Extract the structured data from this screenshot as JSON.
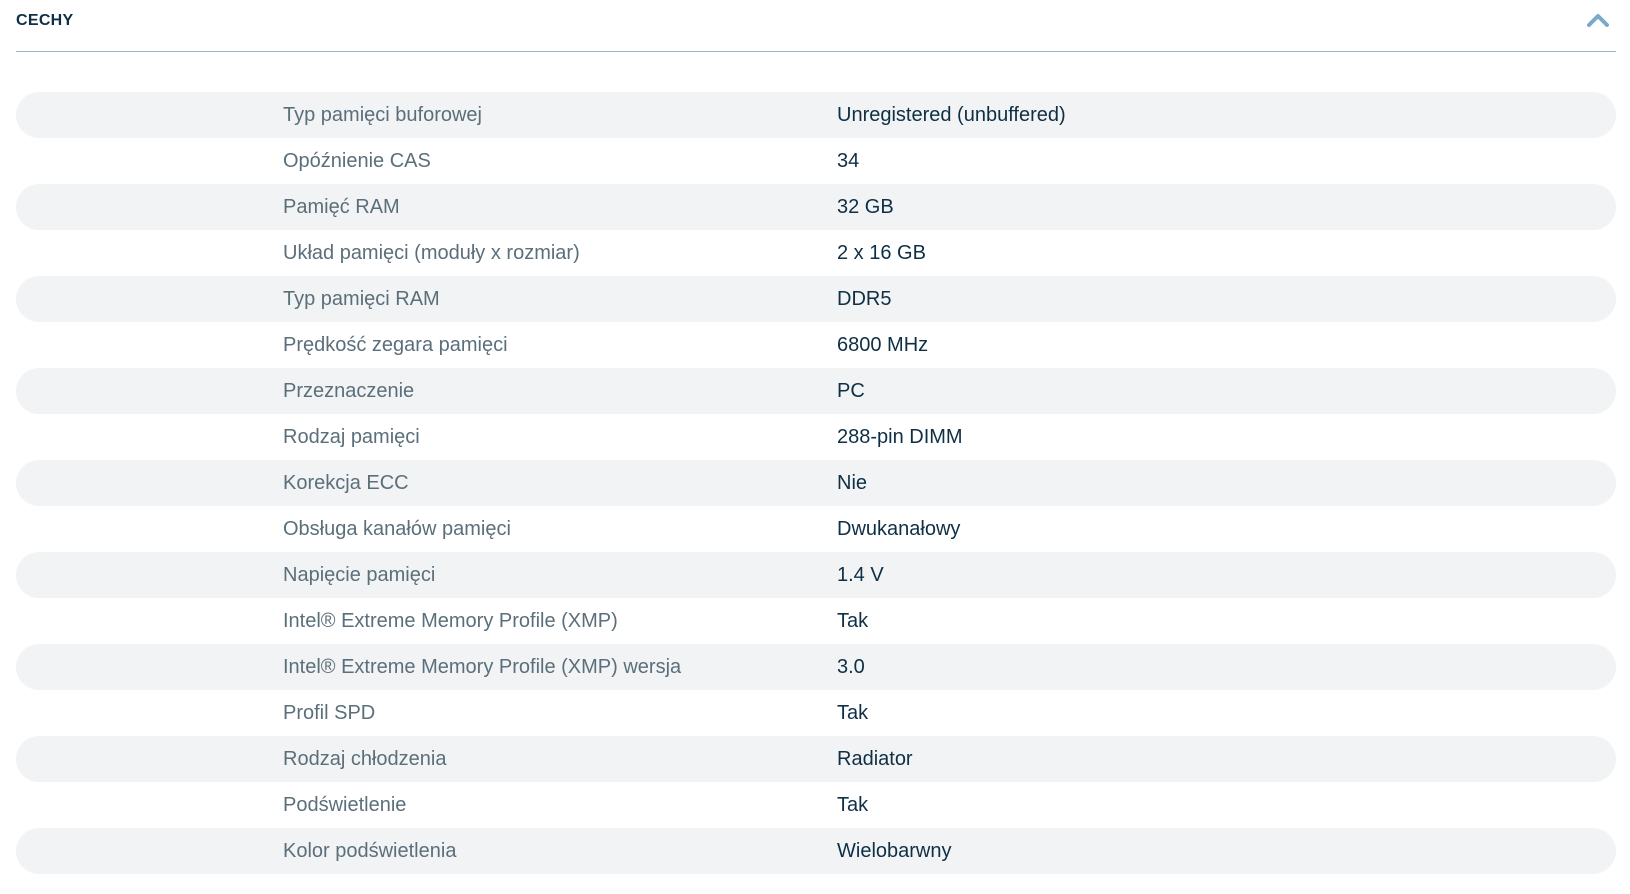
{
  "section": {
    "title": "CECHY",
    "collapse_icon": "chevron-up-icon",
    "accent_color": "#7aa9c9"
  },
  "specs": [
    {
      "label": "Typ pamięci buforowej",
      "value": "Unregistered (unbuffered)"
    },
    {
      "label": "Opóźnienie CAS",
      "value": "34"
    },
    {
      "label": "Pamięć RAM",
      "value": "32 GB"
    },
    {
      "label": "Układ pamięci (moduły x rozmiar)",
      "value": "2 x 16 GB"
    },
    {
      "label": "Typ pamięci RAM",
      "value": "DDR5"
    },
    {
      "label": "Prędkość zegara pamięci",
      "value": "6800 MHz"
    },
    {
      "label": "Przeznaczenie",
      "value": "PC"
    },
    {
      "label": "Rodzaj pamięci",
      "value": "288-pin DIMM"
    },
    {
      "label": "Korekcja ECC",
      "value": "Nie"
    },
    {
      "label": "Obsługa kanałów pamięci",
      "value": "Dwukanałowy"
    },
    {
      "label": "Napięcie pamięci",
      "value": "1.4 V"
    },
    {
      "label": "Intel® Extreme Memory Profile (XMP)",
      "value": "Tak"
    },
    {
      "label": "Intel® Extreme Memory Profile (XMP) wersja",
      "value": "3.0"
    },
    {
      "label": "Profil SPD",
      "value": "Tak"
    },
    {
      "label": "Rodzaj chłodzenia",
      "value": "Radiator"
    },
    {
      "label": "Podświetlenie",
      "value": "Tak"
    },
    {
      "label": "Kolor podświetlenia",
      "value": "Wielobarwny"
    }
  ]
}
